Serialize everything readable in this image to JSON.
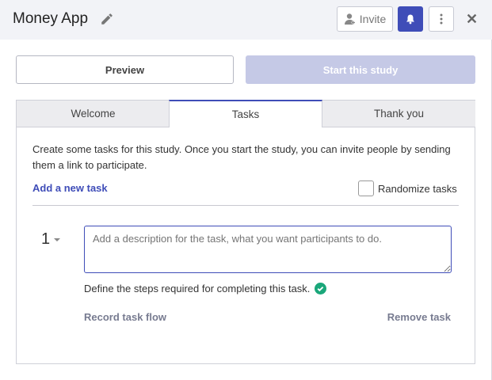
{
  "header": {
    "title": "Money App",
    "invite_label": "Invite",
    "accent": "#3f4db8"
  },
  "actions": {
    "preview_label": "Preview",
    "start_label": "Start this study"
  },
  "tabs": [
    {
      "label": "Welcome"
    },
    {
      "label": "Tasks",
      "active": true
    },
    {
      "label": "Thank you"
    }
  ],
  "tasks": {
    "intro": "Create some tasks for this study. Once you start the study, you can invite people by sending them a link to participate.",
    "add_label": "Add a new task",
    "randomize_label": "Randomize tasks",
    "randomize_checked": false,
    "items": [
      {
        "number": "1",
        "placeholder": "Add a description for the task, what you want participants to do.",
        "value": "",
        "steps_text": "Define the steps required for completing this task.",
        "record_label": "Record task flow",
        "remove_label": "Remove task"
      }
    ]
  }
}
